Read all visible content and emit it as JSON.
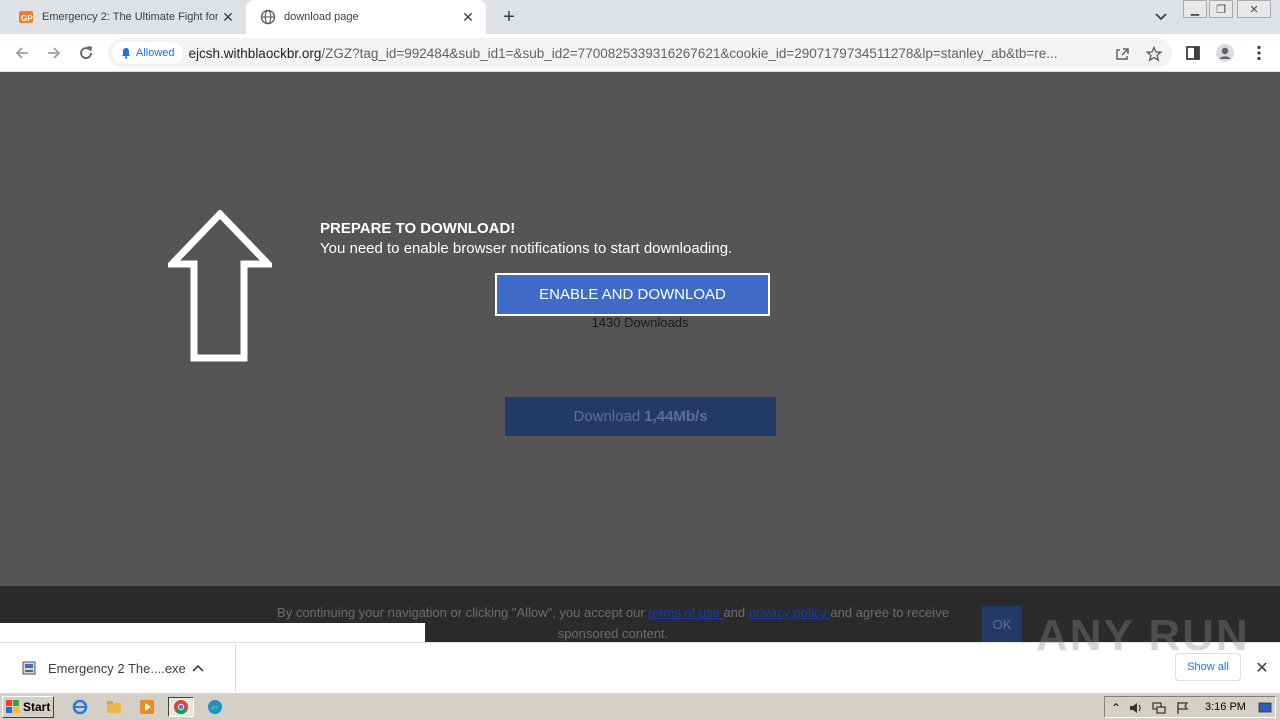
{
  "browser": {
    "tabs": [
      {
        "title": "Emergency 2: The Ultimate Fight for",
        "favicon": "gp-favicon",
        "active": false
      },
      {
        "title": "download page",
        "favicon": "globe-icon",
        "active": true
      }
    ],
    "omnibox": {
      "permission_label": "Allowed",
      "url_host": "ejcsh.withblaockbr.org",
      "url_path": "/ZGZ?tag_id=992484&sub_id1=&sub_id2=7700825339316267621&cookie_id=2907179734511278&lp=stanley_ab&tb=re..."
    }
  },
  "page": {
    "heading": "PREPARE TO DOWNLOAD!",
    "subheading": "You need to enable browser notifications to start downloading.",
    "enable_button": "ENABLE AND DOWNLOAD",
    "downloads_count": "1430 Downloads",
    "download_speed_label": "Download",
    "download_speed_value": "1,44Mb/s",
    "colors": {
      "background": "#555555",
      "button": "#3d6bc6"
    }
  },
  "cookie_bar": {
    "text_before": "By continuing your navigation or clicking \"Allow\", you accept our ",
    "terms_link": "terms of use ",
    "text_and": "and ",
    "privacy_link": "privacy policy ",
    "text_after": "and agree to receive sponsored content.",
    "ok_button": "OK"
  },
  "download_shelf": {
    "item_name": "Emergency 2 The....exe",
    "show_all": "Show all",
    "watermark": "ANY RUN"
  },
  "taskbar": {
    "start_label": "Start",
    "clock": "3:16 PM"
  }
}
